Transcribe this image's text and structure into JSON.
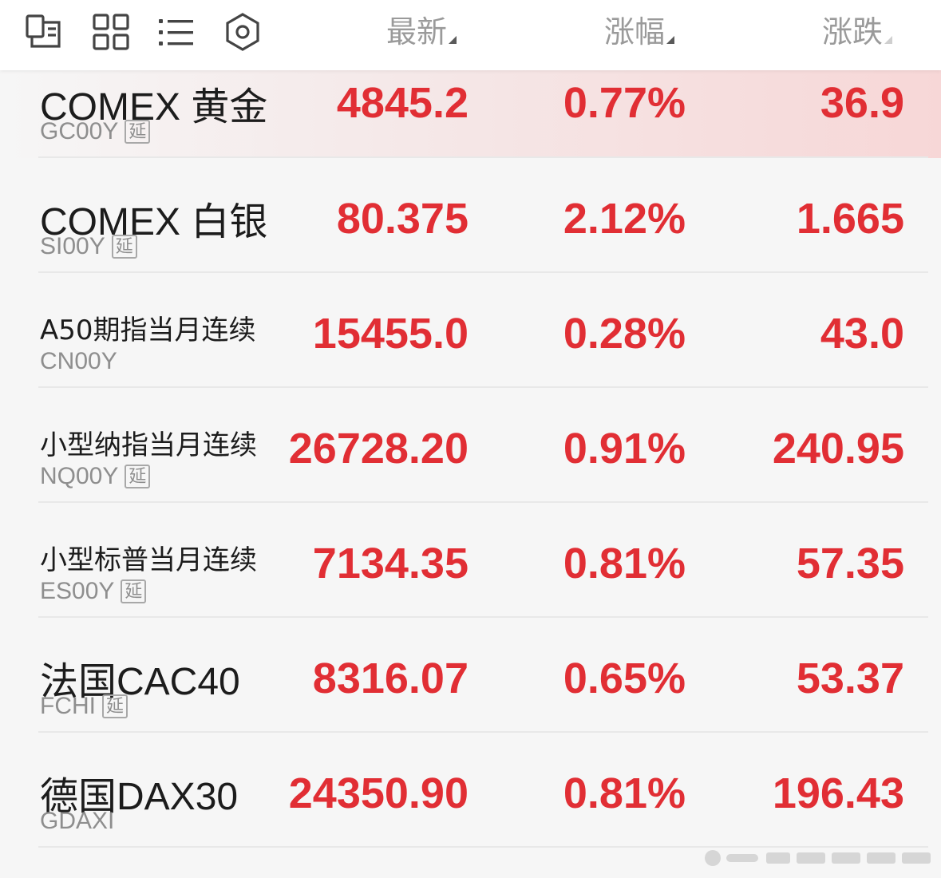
{
  "header": {
    "icons": [
      "grid-list-icon",
      "four-squares-icon",
      "list-icon",
      "hexagon-icon"
    ],
    "columns": {
      "latest": "最新",
      "change_pct": "涨幅",
      "change": "涨跌"
    }
  },
  "colors": {
    "up": "#e12e34",
    "text": "#1c1c1c",
    "subtext": "#8e8e8e"
  },
  "rows": [
    {
      "name": "COMEX 黄金",
      "code": "GC00Y",
      "tag": "延",
      "latest": "4845.2",
      "change_pct": "0.77%",
      "change": "36.9"
    },
    {
      "name": "COMEX 白银",
      "code": "SI00Y",
      "tag": "延",
      "latest": "80.375",
      "change_pct": "2.12%",
      "change": "1.665"
    },
    {
      "name": "A50期指当月连续",
      "code": "CN00Y",
      "tag": "",
      "latest": "15455.0",
      "change_pct": "0.28%",
      "change": "43.0"
    },
    {
      "name": "小型纳指当月连续",
      "code": "NQ00Y",
      "tag": "延",
      "latest": "26728.20",
      "change_pct": "0.91%",
      "change": "240.95"
    },
    {
      "name": "小型标普当月连续",
      "code": "ES00Y",
      "tag": "延",
      "latest": "7134.35",
      "change_pct": "0.81%",
      "change": "57.35"
    },
    {
      "name": "法国CAC40",
      "code": "FCHI",
      "tag": "延",
      "latest": "8316.07",
      "change_pct": "0.65%",
      "change": "53.37"
    },
    {
      "name": "德国DAX30",
      "code": "GDAXI",
      "tag": "",
      "latest": "24350.90",
      "change_pct": "0.81%",
      "change": "196.43"
    }
  ]
}
